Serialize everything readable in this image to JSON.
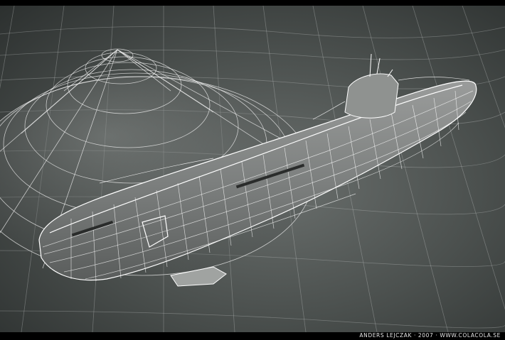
{
  "caption": {
    "credit": "ANDERS LEJCZAK · 2007 · WWW.COLACOLA.SE"
  },
  "colors": {
    "letterbox": "#000000",
    "ground_dark": "#2f3432",
    "ground_light": "#5f6462",
    "wire": "#ffffff",
    "hull": "#8a8d8b"
  },
  "subjects": {
    "primary": "submarine-wireframe",
    "secondary": "dome-wireframe",
    "background": "terrain-grid"
  }
}
